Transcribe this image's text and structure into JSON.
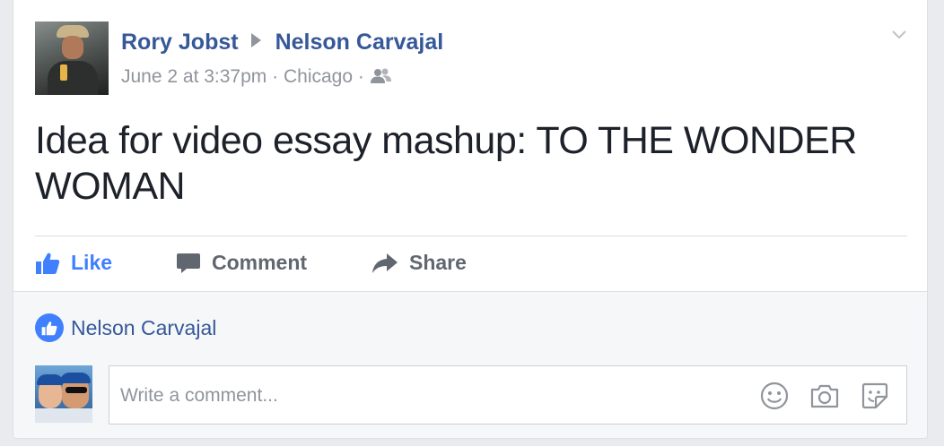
{
  "post": {
    "author": "Rory Jobst",
    "target": "Nelson Carvajal",
    "timestamp": "June 2 at 3:37pm",
    "location": "Chicago",
    "separator": "·",
    "audience_icon": "friends-icon",
    "text": "Idea for video essay mashup: TO THE WONDER WOMAN"
  },
  "actions": {
    "like": "Like",
    "comment": "Comment",
    "share": "Share"
  },
  "likes": {
    "names": "Nelson Carvajal"
  },
  "comment_box": {
    "placeholder": "Write a comment..."
  },
  "colors": {
    "link_blue": "#365899",
    "like_blue": "#4080ff",
    "gray_text": "#90949c",
    "background": "#e9ebee"
  }
}
